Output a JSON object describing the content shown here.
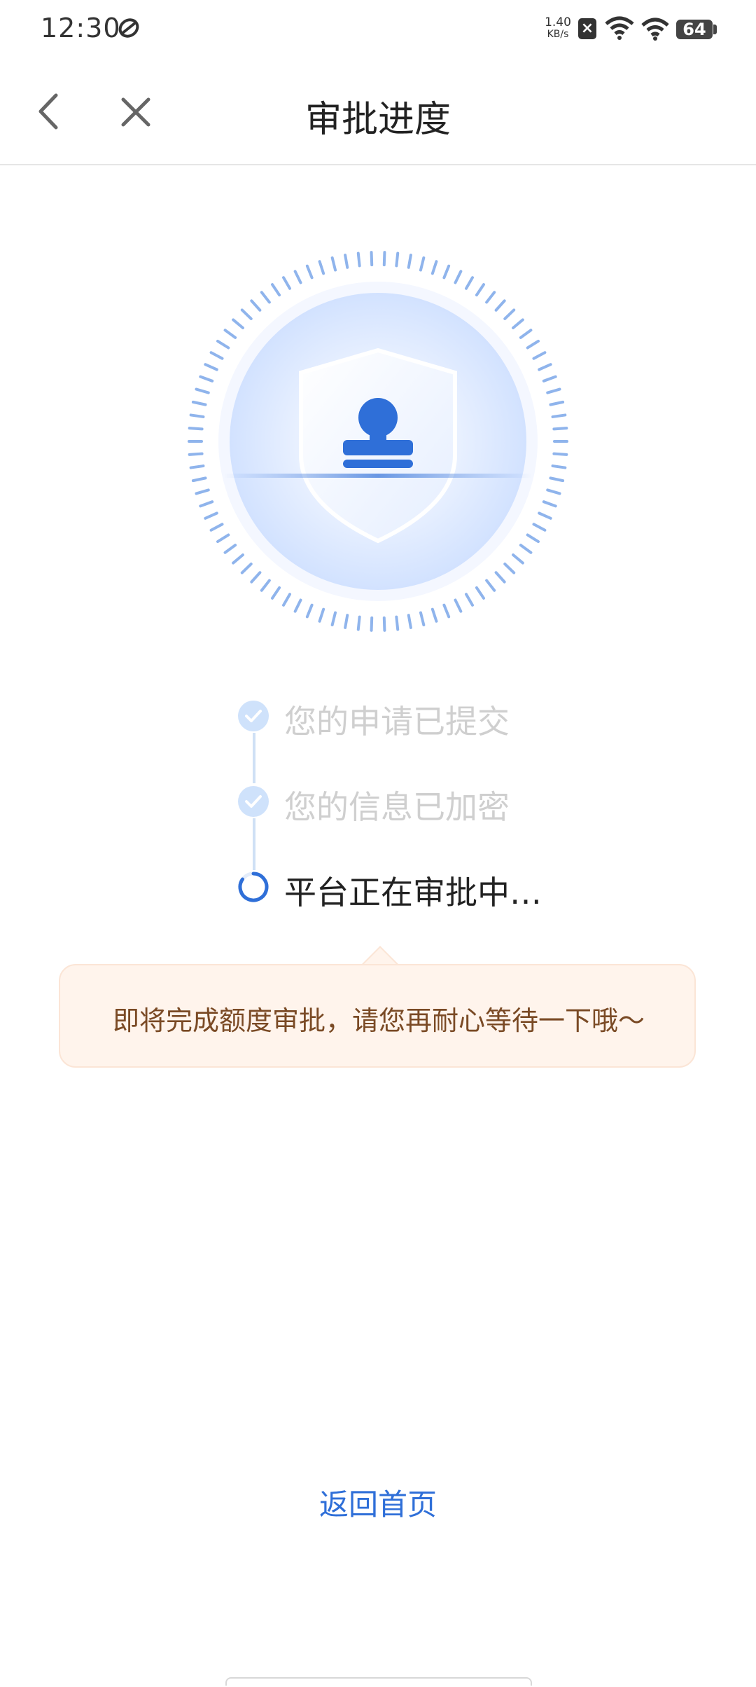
{
  "status_bar": {
    "time": "12:30",
    "net_speed_value": "1.40",
    "net_speed_unit": "KB/s",
    "battery_level": "64",
    "icons": [
      "app-notification-icon",
      "blocked-icon",
      "wifi-icon",
      "wifi-icon",
      "battery-icon"
    ]
  },
  "nav": {
    "title": "审批进度",
    "back_icon": "chevron-left-icon",
    "close_icon": "close-icon"
  },
  "hero": {
    "icon": "shield-stamp-icon",
    "accent_color": "#2f6fd8"
  },
  "steps": [
    {
      "label": "您的申请已提交",
      "status": "done"
    },
    {
      "label": "您的信息已加密",
      "status": "done"
    },
    {
      "label": "平台正在审批中…",
      "status": "in-progress"
    }
  ],
  "tip": {
    "text": "即将完成额度审批，请您再耐心等待一下哦～"
  },
  "footer": {
    "home_link": "返回首页"
  }
}
